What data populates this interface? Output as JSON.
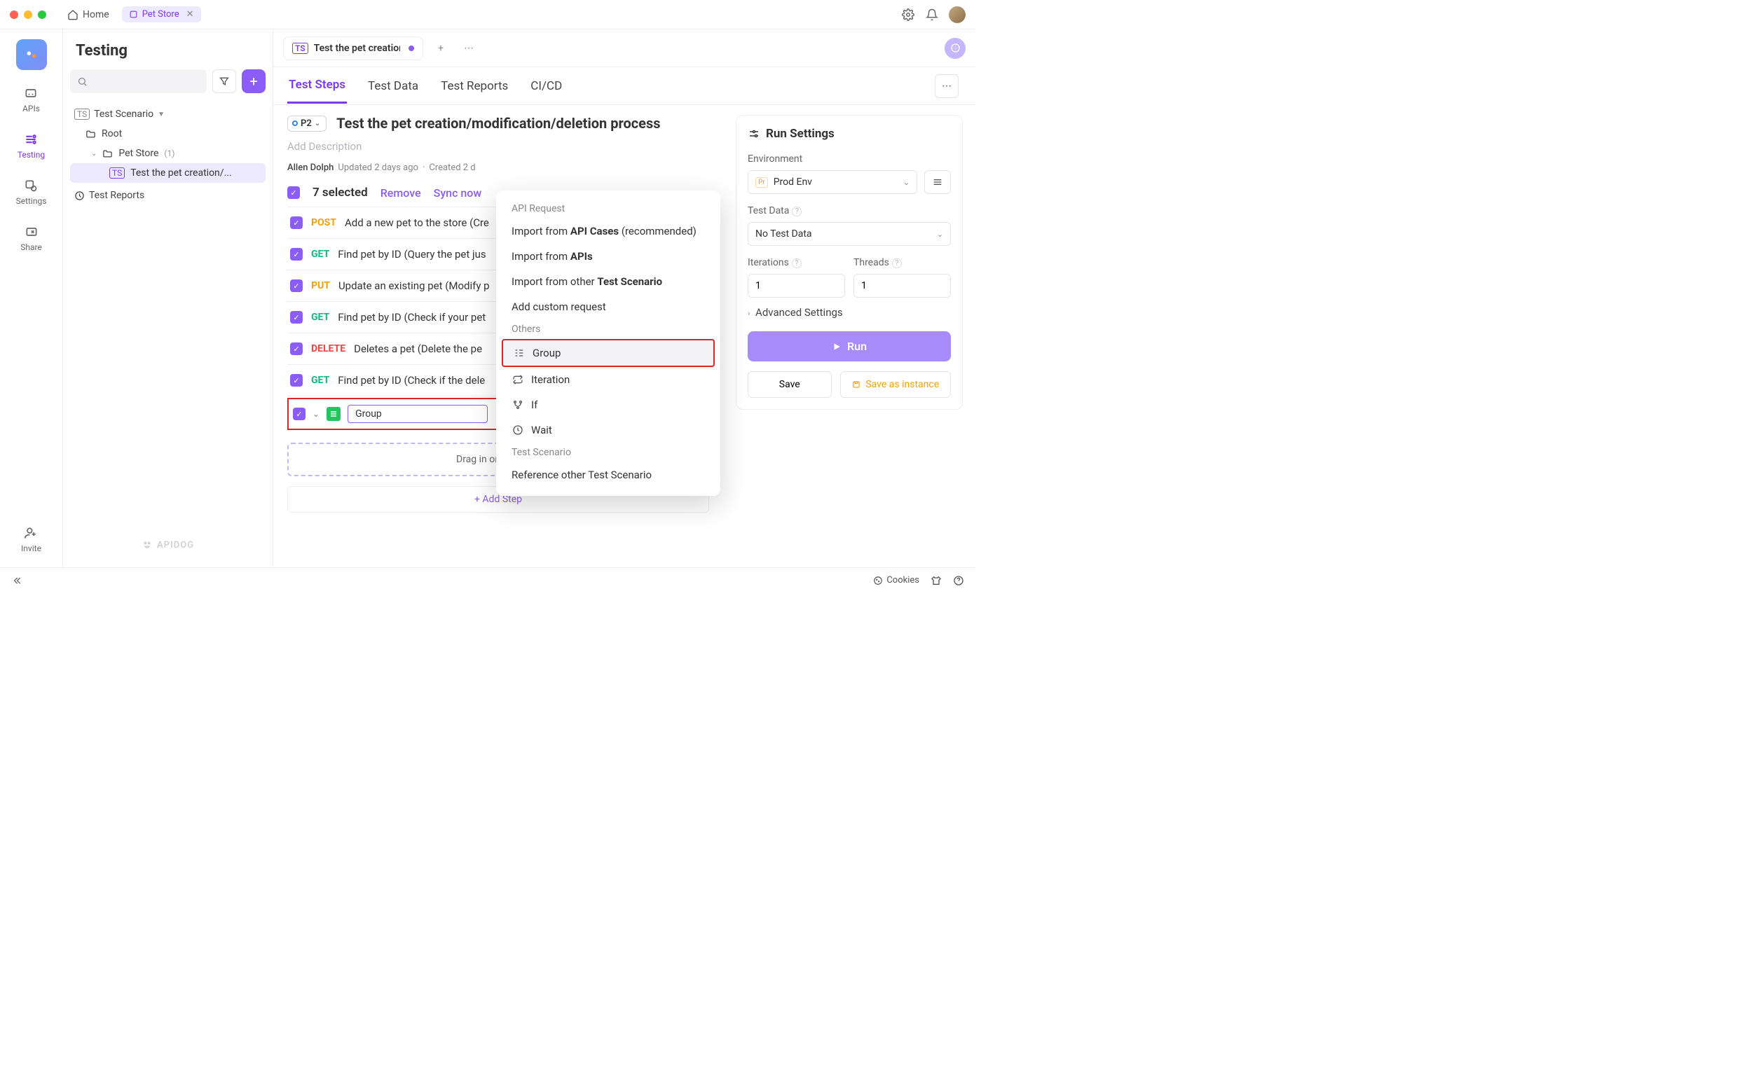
{
  "titlebar": {
    "home_label": "Home",
    "tab_label": "Pet Store"
  },
  "rail": {
    "apis": "APIs",
    "testing": "Testing",
    "settings": "Settings",
    "share": "Share",
    "invite": "Invite"
  },
  "sidebar": {
    "title": "Testing",
    "scenario_hdr": "Test Scenario",
    "root": "Root",
    "petstore": "Pet Store",
    "petstore_count": "(1)",
    "scenario_item": "Test the pet creation/...",
    "reports": "Test Reports",
    "brand": "APIDOG"
  },
  "maintab": {
    "label": "Test the pet creation"
  },
  "subnav": {
    "steps": "Test Steps",
    "data": "Test Data",
    "reports": "Test Reports",
    "cicd": "CI/CD"
  },
  "scenario": {
    "priority": "P2",
    "title": "Test the pet creation/modification/deletion process",
    "desc_placeholder": "Add Description",
    "author": "Allen Dolph",
    "updated": "Updated 2 days ago",
    "created": "Created 2 d"
  },
  "selbar": {
    "count": "7 selected",
    "remove": "Remove",
    "sync": "Sync now"
  },
  "steps": [
    {
      "method": "POST",
      "cls": "m-post",
      "desc": "Add a new pet to the store (Cre"
    },
    {
      "method": "GET",
      "cls": "m-get",
      "desc": "Find pet by ID (Query the pet jus"
    },
    {
      "method": "PUT",
      "cls": "m-put",
      "desc": "Update an existing pet (Modify p"
    },
    {
      "method": "GET",
      "cls": "m-get",
      "desc": "Find pet by ID (Check if your pet"
    },
    {
      "method": "DELETE",
      "cls": "m-del",
      "desc": "Deletes a pet (Delete the pe"
    },
    {
      "method": "GET",
      "cls": "m-get",
      "desc": "Find pet by ID (Check if the dele"
    }
  ],
  "group_input": "Group",
  "addstep": {
    "drag": "Drag in or ",
    "add": "Add Step",
    "btn": "+ Add Step"
  },
  "run": {
    "header": "Run Settings",
    "env_lbl": "Environment",
    "env_val": "Prod Env",
    "env_badge": "Pr",
    "data_lbl": "Test Data",
    "data_val": "No Test Data",
    "iter_lbl": "Iterations",
    "threads_lbl": "Threads",
    "iter_val": "1",
    "threads_val": "1",
    "adv": "Advanced Settings",
    "run_btn": "Run",
    "save": "Save",
    "save_as": "Save as instance"
  },
  "bottom": {
    "cookies": "Cookies"
  },
  "ctx": {
    "api_req": "API Request",
    "imp_cases_pre": "Import from ",
    "imp_cases_b": "API Cases",
    "imp_cases_post": " (recommended)",
    "imp_apis_pre": "Import from ",
    "imp_apis_b": "APIs",
    "imp_ts_pre": "Import from other ",
    "imp_ts_b": "Test Scenario",
    "custom": "Add custom request",
    "others": "Others",
    "group": "Group",
    "iteration": "Iteration",
    "if": "If",
    "wait": "Wait",
    "ts_hdr": "Test Scenario",
    "ref_ts": "Reference other Test Scenario"
  }
}
